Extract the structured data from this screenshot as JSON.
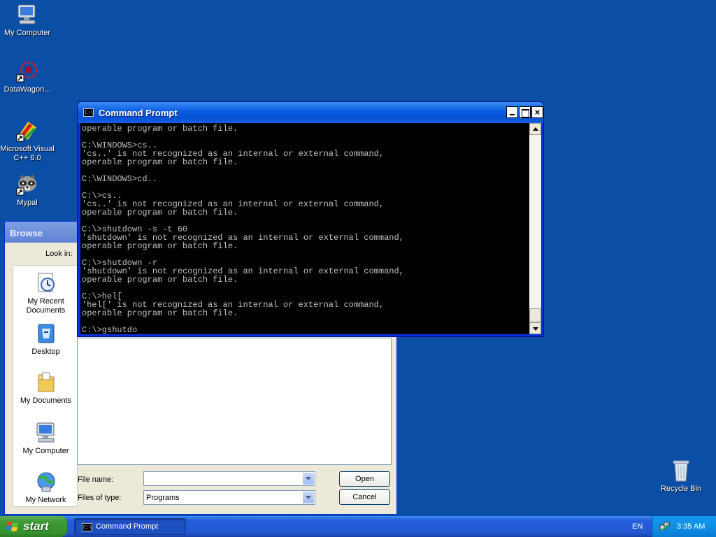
{
  "desktop": {
    "icons": [
      {
        "label": "My Computer"
      },
      {
        "label": "DataWagon..."
      },
      {
        "label": "Microsoft Visual C++ 6.0"
      },
      {
        "label": "Mypal"
      },
      {
        "label": "Recycle Bin"
      }
    ]
  },
  "browse_dialog": {
    "title": "Browse",
    "look_in_label": "Look in:",
    "places": [
      {
        "label": "My Recent Documents"
      },
      {
        "label": "Desktop"
      },
      {
        "label": "My Documents"
      },
      {
        "label": "My Computer"
      },
      {
        "label": "My Network"
      }
    ],
    "file_name_label": "File name:",
    "file_name_value": "",
    "files_of_type_label": "Files of type:",
    "files_of_type_value": "Programs",
    "open_button": "Open",
    "cancel_button": "Cancel"
  },
  "command_prompt": {
    "title": "Command Prompt",
    "lines": [
      "operable program or batch file.",
      "",
      "C:\\WINDOWS>cs..",
      "'cs..' is not recognized as an internal or external command,",
      "operable program or batch file.",
      "",
      "C:\\WINDOWS>cd..",
      "",
      "C:\\>cs..",
      "'cs..' is not recognized as an internal or external command,",
      "operable program or batch file.",
      "",
      "C:\\>shutdown -s -t 60",
      "'shutdown' is not recognized as an internal or external command,",
      "operable program or batch file.",
      "",
      "C:\\>shutdown -r",
      "'shutdown' is not recognized as an internal or external command,",
      "operable program or batch file.",
      "",
      "C:\\>hel[",
      "'hel[' is not recognized as an internal or external command,",
      "operable program or batch file.",
      "",
      "C:\\>gshutdo"
    ]
  },
  "taskbar": {
    "start_label": "start",
    "tasks": [
      {
        "label": "Command Prompt"
      }
    ],
    "language": "EN",
    "clock": "3:35 AM"
  },
  "colors": {
    "desktop_bg": "#0b4ea5",
    "titlebar_active": "#0a5be0",
    "start_green": "#3c9a33",
    "console_fg": "#c0c0c0"
  }
}
